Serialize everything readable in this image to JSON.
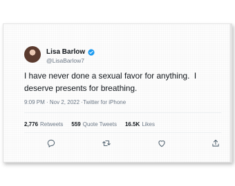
{
  "tweet": {
    "author_name": "Lisa Barlow",
    "author_handle": "@LisaBarlow7",
    "text": "I have never done a sexual favor for anything.  I deserve presents for breathing.",
    "time": "9:09 PM · Nov 2, 2022 · ",
    "source": "Twitter for iPhone",
    "retweets_count": "2,776",
    "retweets_label": "Retweets",
    "quote_count": "559",
    "quote_label": "Quote Tweets",
    "likes_count": "16.5K",
    "likes_label": "Likes"
  },
  "icons": {
    "verified": "verified-badge-icon",
    "reply": "reply-icon",
    "retweet": "retweet-icon",
    "like": "heart-icon",
    "share": "share-icon"
  },
  "colors": {
    "verified": "#1d9bf0",
    "text": "#0f1419",
    "secondary": "#6b7785"
  }
}
